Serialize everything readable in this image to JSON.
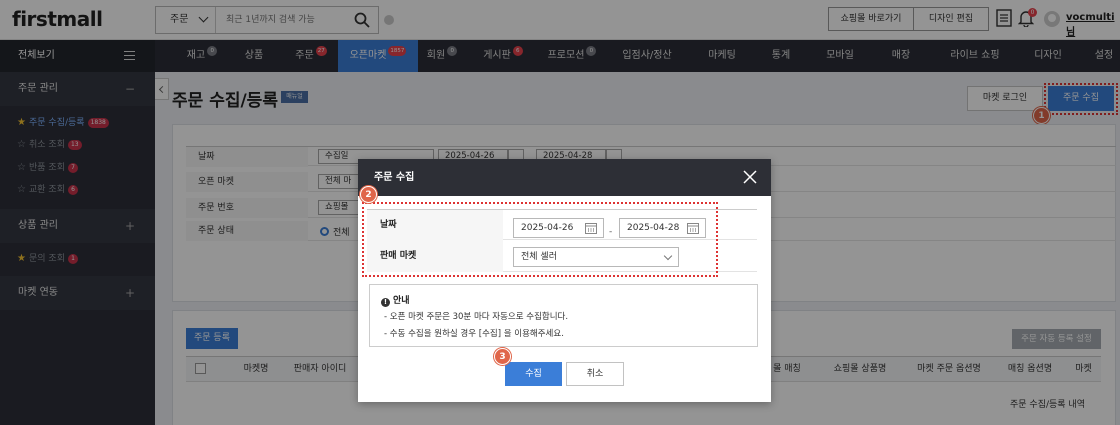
{
  "header": {
    "logo": "firstmall",
    "search_type": "주문",
    "search_placeholder": "최근 1년까지 검색 가능",
    "btn_shop": "쇼핑몰 바로가기",
    "btn_design": "디자인 편집",
    "bell_count": "0",
    "username": "vocmulti님"
  },
  "nav": {
    "all_label": "전체보기",
    "items": [
      {
        "label": "재고",
        "badge": "0"
      },
      {
        "label": "상품",
        "badge": ""
      },
      {
        "label": "주문",
        "badge": "27"
      },
      {
        "label": "오픈마켓",
        "badge": "1857"
      },
      {
        "label": "회원",
        "badge": "0"
      },
      {
        "label": "게시판",
        "badge": "6"
      },
      {
        "label": "프로모션",
        "badge": "0"
      },
      {
        "label": "입점사/정산",
        "badge": ""
      },
      {
        "label": "마케팅",
        "badge": ""
      },
      {
        "label": "통계",
        "badge": ""
      },
      {
        "label": "모바일",
        "badge": ""
      },
      {
        "label": "매장",
        "badge": ""
      },
      {
        "label": "라이브 쇼핑",
        "badge": ""
      },
      {
        "label": "디자인",
        "badge": ""
      },
      {
        "label": "설정",
        "badge": ""
      }
    ]
  },
  "sidebar": {
    "section1": "주문 관리",
    "items": [
      {
        "label": "주문 수집/등록",
        "badge": "1838"
      },
      {
        "label": "취소 조회",
        "badge": "13"
      },
      {
        "label": "반품 조회",
        "badge": "7"
      },
      {
        "label": "교환 조회",
        "badge": "6"
      }
    ],
    "section2": "상품 관리",
    "inquiry": {
      "label": "문의 조회",
      "badge": "1"
    },
    "section3": "마켓 연동"
  },
  "page": {
    "title": "주문 수집/등록",
    "manual_badge": "매뉴얼",
    "btn_market_login": "마켓 로그인",
    "btn_collect": "주문 수집"
  },
  "filter": {
    "date_label": "날짜",
    "date_type": "수집일",
    "date_from": "2025-04-26",
    "date_to": "2025-04-28",
    "market_label": "오픈 마켓",
    "market_value": "전체 마",
    "order_no_label": "주문 번호",
    "order_no_value": "쇼핑몰",
    "status_label": "주문 상태",
    "status_value": "전체"
  },
  "list": {
    "btn_register": "주문 등록",
    "btn_auto_setting": "주문 자동 등록 설정",
    "headers": [
      "마켓명",
      "판매자 아이디",
      "몰 매칭",
      "쇼핑몰 상품명",
      "마켓 주문 옵션명",
      "매칭 옵션명",
      "마켓"
    ],
    "history": "주문 수집/등록 내역"
  },
  "modal": {
    "title": "주문 수집",
    "date_label": "날짜",
    "date_from": "2025-04-26",
    "date_to": "2025-04-28",
    "dash": "-",
    "market_label": "판매 마켓",
    "market_value": "전체 셀러",
    "notice_title": "안내",
    "notice_lines": [
      "- 오픈 마켓 주문은 30분 마다 자동으로 수집합니다.",
      "- 수동 수집을 원하실 경우 [수집] 을 이용해주세요."
    ],
    "btn_collect": "수집",
    "btn_cancel": "취소"
  },
  "steps": [
    "1",
    "2",
    "3"
  ],
  "colors": {
    "accent": "#3b7ed8",
    "step": "#e0664a",
    "dark": "#2b2e37"
  }
}
